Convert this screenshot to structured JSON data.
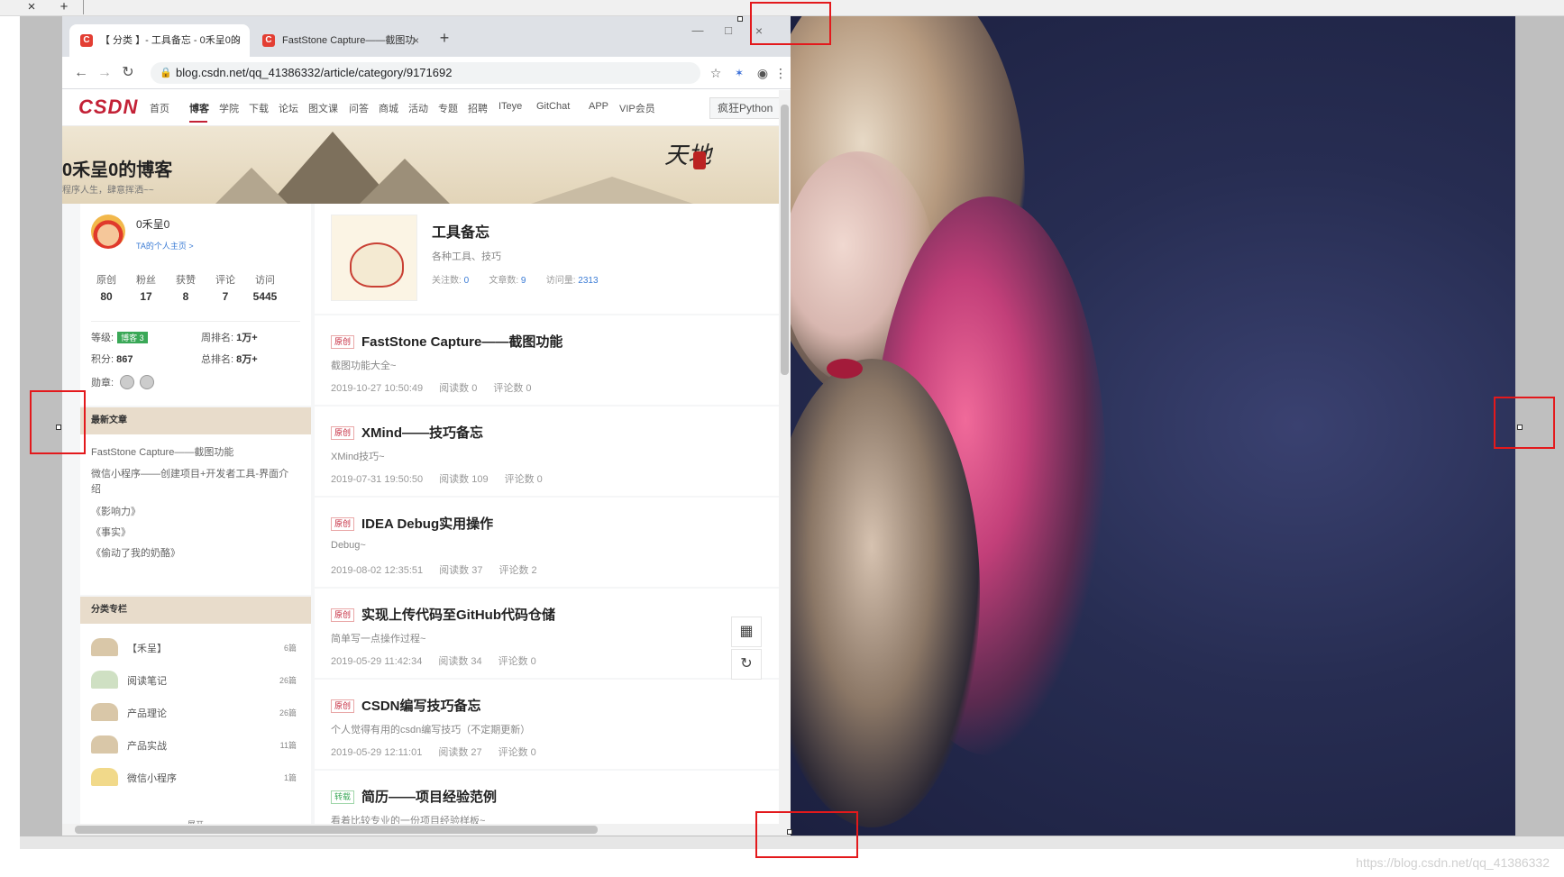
{
  "editor": {
    "close_symbol": "×",
    "new_symbol": "+",
    "watermark": "https://blog.csdn.net/qq_41386332"
  },
  "browser": {
    "tabs": [
      {
        "label": "【 分类 】- 工具备忘 - 0禾呈0的",
        "favicon": "C"
      },
      {
        "label": "FastStone Capture——截图功",
        "favicon": "C"
      }
    ],
    "new_tab": "+",
    "url": "blog.csdn.net/qq_41386332/article/category/9171692",
    "window_close": "×",
    "window_max": "□",
    "window_min": "—"
  },
  "csdn_nav": {
    "logo": "CSDN",
    "items": [
      "首页",
      "博客",
      "学院",
      "下载",
      "论坛",
      "图文课",
      "问答",
      "商城",
      "活动",
      "专题",
      "招聘",
      "ITeye",
      "GitChat",
      "APP",
      "VIP会员"
    ],
    "search_value": "疯狂Python"
  },
  "banner": {
    "title": "0禾呈0的博客",
    "subtitle": "程序人生，肆意挥洒~~"
  },
  "profile": {
    "name": "0禾呈0",
    "homepage_link": "TA的个人主页 >",
    "stats": [
      {
        "label": "原创",
        "value": "80"
      },
      {
        "label": "粉丝",
        "value": "17"
      },
      {
        "label": "获赞",
        "value": "8"
      },
      {
        "label": "评论",
        "value": "7"
      },
      {
        "label": "访问",
        "value": "5445"
      }
    ],
    "level_label": "等级:",
    "level_badge": "博客 3",
    "week_rank_label": "周排名:",
    "week_rank": "1万+",
    "points_label": "积分:",
    "points": "867",
    "total_rank_label": "总排名:",
    "total_rank": "8万+",
    "medals_label": "勋章:"
  },
  "recent": {
    "heading": "最新文章",
    "items": [
      "FastStone Capture——截图功能",
      "微信小程序——创建项目+开发者工具-界面介绍",
      "《影响力》",
      "《事实》",
      "《偷动了我的奶酪》"
    ]
  },
  "categories": {
    "heading": "分类专栏",
    "items": [
      {
        "name": "【禾呈】",
        "count": "6篇"
      },
      {
        "name": "阅读笔记",
        "count": "26篇"
      },
      {
        "name": "产品理论",
        "count": "26篇"
      },
      {
        "name": "产品实战",
        "count": "11篇"
      },
      {
        "name": "微信小程序",
        "count": "1篇"
      }
    ],
    "expand": "展开"
  },
  "column": {
    "title": "工具备忘",
    "desc": "各种工具、技巧",
    "follow_label": "关注数:",
    "follow": "0",
    "articles_label": "文章数:",
    "articles": "9",
    "visits_label": "访问量:",
    "visits": "2313"
  },
  "articles": [
    {
      "badge": "原创",
      "title": "FastStone Capture——截图功能",
      "desc": "截图功能大全~",
      "date": "2019-10-27 10:50:49",
      "reads": "阅读数 0",
      "comments": "评论数 0"
    },
    {
      "badge": "原创",
      "title": "XMind——技巧备忘",
      "desc": "XMind技巧~",
      "date": "2019-07-31 19:50:50",
      "reads": "阅读数 109",
      "comments": "评论数 0"
    },
    {
      "badge": "原创",
      "title": "IDEA Debug实用操作",
      "desc": "Debug~",
      "date": "2019-08-02 12:35:51",
      "reads": "阅读数 37",
      "comments": "评论数 2"
    },
    {
      "badge": "原创",
      "title": "实现上传代码至GitHub代码仓储",
      "desc": "简单写一点操作过程~",
      "date": "2019-05-29 11:42:34",
      "reads": "阅读数 34",
      "comments": "评论数 0"
    },
    {
      "badge": "原创",
      "title": "CSDN编写技巧备忘",
      "desc": "个人觉得有用的csdn编写技巧（不定期更新）",
      "date": "2019-05-29 12:11:01",
      "reads": "阅读数 27",
      "comments": "评论数 0"
    },
    {
      "badge": "转载",
      "title": "简历——项目经验范例",
      "desc": "看着比较专业的一份项目经验样板~",
      "date": "",
      "reads": "",
      "comments": ""
    }
  ],
  "colors": {
    "csdn_red": "#c32136",
    "highlight_red": "#e3191c",
    "photo_bg": "#272d52"
  }
}
